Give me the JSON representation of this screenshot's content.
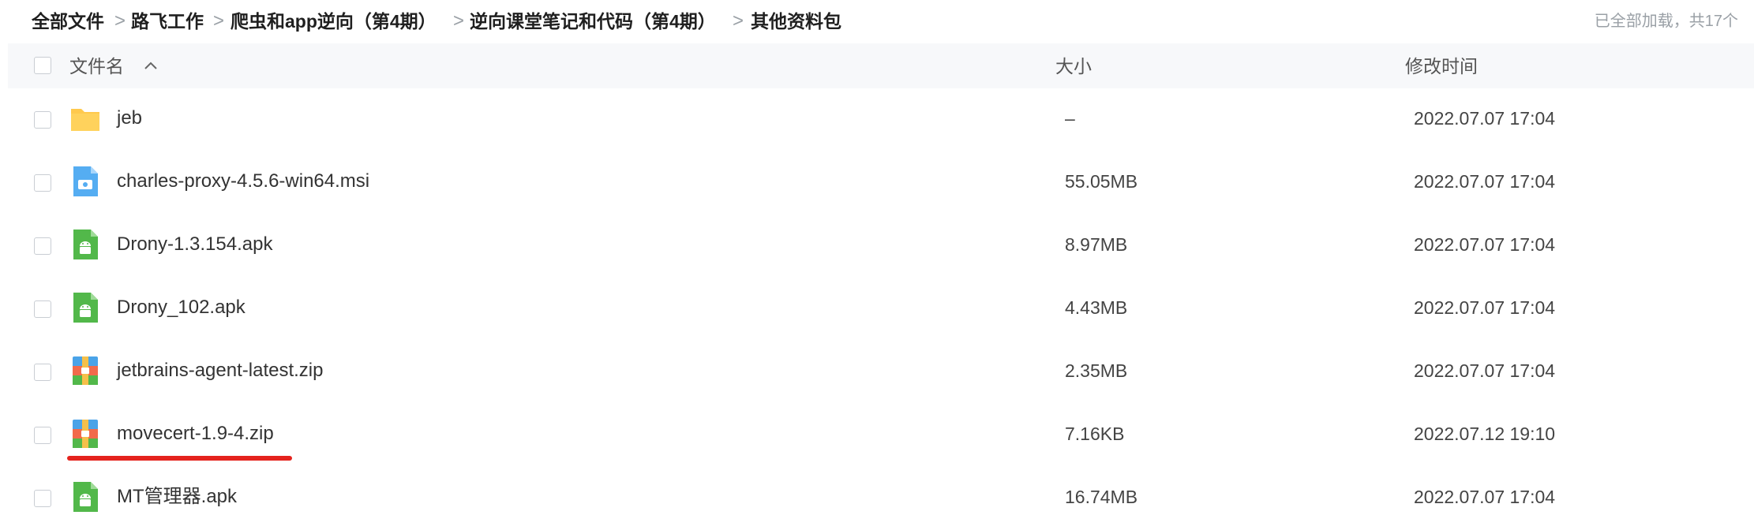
{
  "breadcrumb": {
    "items": [
      "全部文件",
      "路飞工作",
      "爬虫和app逆向（第4期）",
      "逆向课堂笔记和代码（第4期）",
      "其他资料包"
    ],
    "separator": ">"
  },
  "status_text": "已全部加载，共17个",
  "columns": {
    "name": "文件名",
    "size": "大小",
    "modified": "修改时间"
  },
  "files": [
    {
      "name": "jeb",
      "size": "–",
      "modified": "2022.07.07 17:04",
      "icon": "folder-icon"
    },
    {
      "name": "charles-proxy-4.5.6-win64.msi",
      "size": "55.05MB",
      "modified": "2022.07.07 17:04",
      "icon": "msi-file-icon"
    },
    {
      "name": "Drony-1.3.154.apk",
      "size": "8.97MB",
      "modified": "2022.07.07 17:04",
      "icon": "apk-file-icon"
    },
    {
      "name": "Drony_102.apk",
      "size": "4.43MB",
      "modified": "2022.07.07 17:04",
      "icon": "apk-file-icon"
    },
    {
      "name": "jetbrains-agent-latest.zip",
      "size": "2.35MB",
      "modified": "2022.07.07 17:04",
      "icon": "zip-file-icon"
    },
    {
      "name": "movecert-1.9-4.zip",
      "size": "7.16KB",
      "modified": "2022.07.12 19:10",
      "icon": "zip-file-icon"
    },
    {
      "name": "MT管理器.apk",
      "size": "16.74MB",
      "modified": "2022.07.07 17:04",
      "icon": "apk-file-icon"
    }
  ],
  "colors": {
    "folder": "#ffc94d",
    "msi": "#55adf2",
    "apk": "#52b84a",
    "annotation": "#e5231d"
  }
}
